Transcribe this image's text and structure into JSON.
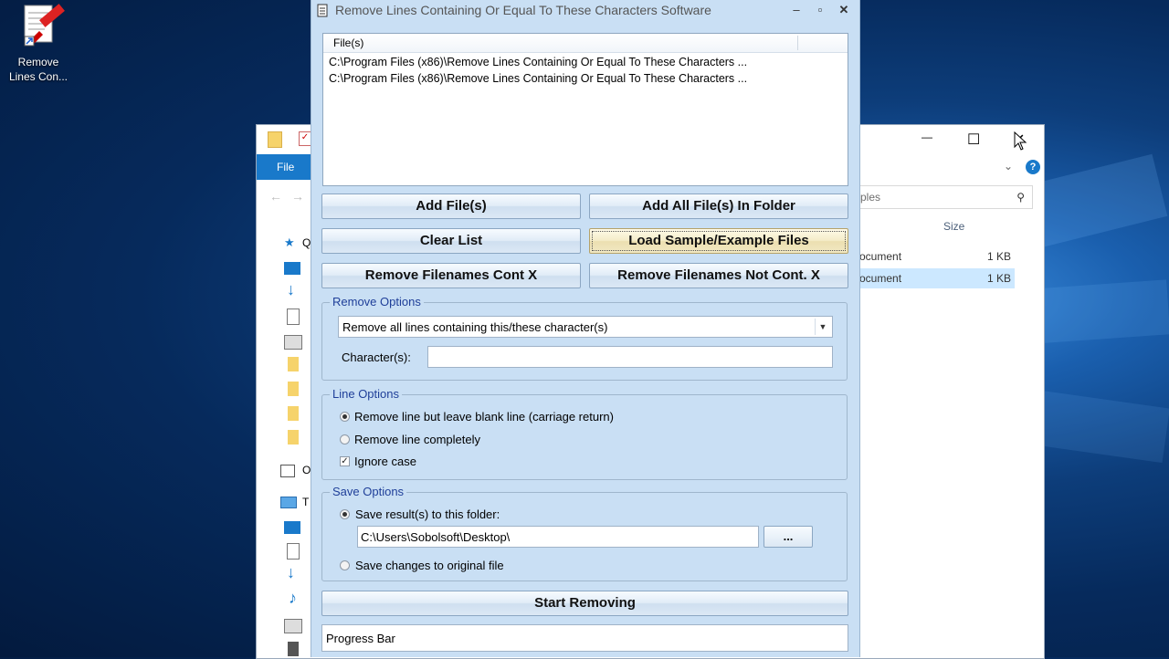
{
  "desktop": {
    "icon_label": "Remove Lines Con..."
  },
  "explorer": {
    "ribbon_tab": "File",
    "search_placeholder": "ples",
    "column_size": "Size",
    "rows": [
      {
        "name": "ocument",
        "size": "1 KB"
      },
      {
        "name": "ocument",
        "size": "1 KB"
      }
    ],
    "nav_letters": [
      "Q",
      "O",
      "T"
    ],
    "minimize": "—",
    "maximize": "☐",
    "close": "✕"
  },
  "app": {
    "title": "Remove Lines Containing Or Equal To These Characters Software",
    "title_buttons": {
      "minimize": "–",
      "maximize": "▫",
      "close": "✕"
    },
    "file_list": {
      "header": "File(s)",
      "items": [
        "C:\\Program Files (x86)\\Remove Lines Containing Or Equal To These Characters ...",
        "C:\\Program Files (x86)\\Remove Lines Containing Or Equal To These Characters ..."
      ]
    },
    "buttons": {
      "add_files": "Add File(s)",
      "add_folder": "Add All File(s) In Folder",
      "clear_list": "Clear List",
      "load_sample": "Load Sample/Example Files",
      "remove_cont": "Remove Filenames Cont X",
      "remove_not_cont": "Remove Filenames Not Cont. X",
      "browse": "...",
      "start": "Start Removing"
    },
    "remove_options": {
      "legend": "Remove Options",
      "mode_selected": "Remove all lines containing this/these character(s)",
      "characters_label": "Character(s):",
      "characters_value": ""
    },
    "line_options": {
      "legend": "Line Options",
      "opt_blank": "Remove line but leave blank line (carriage return)",
      "opt_completely": "Remove line completely",
      "ignore_case": "Ignore case"
    },
    "save_options": {
      "legend": "Save Options",
      "opt_folder": "Save result(s) to this folder:",
      "folder_value": "C:\\Users\\Sobolsoft\\Desktop\\",
      "opt_original": "Save changes to original file"
    },
    "progress_label": "Progress Bar"
  },
  "colors": {
    "app_bg": "#c9dff4",
    "legend_text": "#1f3f99",
    "explorer_ribbon": "#1979ca"
  }
}
